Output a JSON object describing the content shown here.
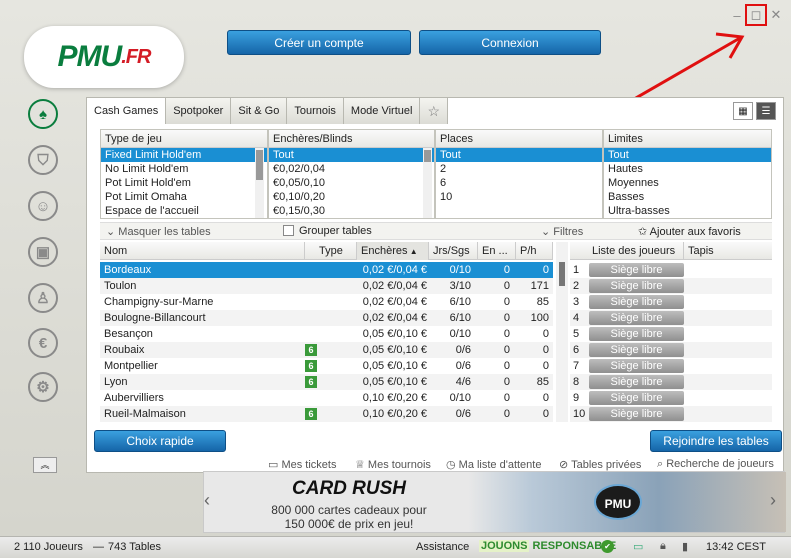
{
  "brand": {
    "main": "PMU",
    "tld": ".FR"
  },
  "header": {
    "create_account": "Créer un compte",
    "login": "Connexion",
    "minimize": "–",
    "restore": "◻",
    "close": "✕"
  },
  "sidebar": {
    "icons": [
      "spade-icon",
      "shield-icon",
      "group-icon",
      "gift-icon",
      "user-icon",
      "euro-icon",
      "wrench-icon"
    ]
  },
  "tabs": [
    "Cash Games",
    "Spotpoker",
    "Sit & Go",
    "Tournois",
    "Mode Virtuel"
  ],
  "filters": {
    "type": {
      "header": "Type de jeu",
      "items": [
        "Fixed Limit Hold'em",
        "No Limit Hold'em",
        "Pot Limit Hold'em",
        "Pot Limit Omaha",
        "Espace de l'accueil"
      ]
    },
    "blinds": {
      "header": "Enchères/Blinds",
      "items": [
        "Tout",
        "€0,02/0,04",
        "€0,05/0,10",
        "€0,10/0,20",
        "€0,15/0,30"
      ]
    },
    "places": {
      "header": "Places",
      "items": [
        "Tout",
        "2",
        "6",
        "10"
      ]
    },
    "limits": {
      "header": "Limites",
      "items": [
        "Tout",
        "Hautes",
        "Moyennes",
        "Basses",
        "Ultra-basses"
      ]
    }
  },
  "toolbar": {
    "hide_tables": "Masquer les tables",
    "group_tables": "Grouper tables",
    "filters": "Filtres",
    "add_fav": "Ajouter aux favoris"
  },
  "table": {
    "headers": {
      "name": "Nom",
      "type": "Type",
      "stakes": "Enchères",
      "players": "Jrs/Sgs",
      "waiting": "En ...",
      "pf": "P/h",
      "seat": "Liste des joueurs",
      "mats": "Tapis"
    },
    "rows": [
      {
        "name": "Bordeaux",
        "six": "",
        "stakes": "0,02 €/0,04 €",
        "players": "0/10",
        "waiting": "0",
        "pf": "0"
      },
      {
        "name": "Toulon",
        "six": "",
        "stakes": "0,02 €/0,04 €",
        "players": "3/10",
        "waiting": "0",
        "pf": "171"
      },
      {
        "name": "Champigny-sur-Marne",
        "six": "",
        "stakes": "0,02 €/0,04 €",
        "players": "6/10",
        "waiting": "0",
        "pf": "85"
      },
      {
        "name": "Boulogne-Billancourt",
        "six": "",
        "stakes": "0,02 €/0,04 €",
        "players": "6/10",
        "waiting": "0",
        "pf": "100"
      },
      {
        "name": "Besançon",
        "six": "",
        "stakes": "0,05 €/0,10 €",
        "players": "0/10",
        "waiting": "0",
        "pf": "0"
      },
      {
        "name": "Roubaix",
        "six": "6",
        "stakes": "0,05 €/0,10 €",
        "players": "0/6",
        "waiting": "0",
        "pf": "0"
      },
      {
        "name": "Montpellier",
        "six": "6",
        "stakes": "0,05 €/0,10 €",
        "players": "0/6",
        "waiting": "0",
        "pf": "0"
      },
      {
        "name": "Lyon",
        "six": "6",
        "stakes": "0,05 €/0,10 €",
        "players": "4/6",
        "waiting": "0",
        "pf": "85"
      },
      {
        "name": "Aubervilliers",
        "six": "",
        "stakes": "0,10 €/0,20 €",
        "players": "0/10",
        "waiting": "0",
        "pf": "0"
      },
      {
        "name": "Rueil-Malmaison",
        "six": "6",
        "stakes": "0,10 €/0,20 €",
        "players": "0/6",
        "waiting": "0",
        "pf": "0"
      }
    ],
    "seats": [
      {
        "n": "1",
        "label": "Siège libre"
      },
      {
        "n": "2",
        "label": "Siège libre"
      },
      {
        "n": "3",
        "label": "Siège libre"
      },
      {
        "n": "4",
        "label": "Siège libre"
      },
      {
        "n": "5",
        "label": "Siège libre"
      },
      {
        "n": "6",
        "label": "Siège libre"
      },
      {
        "n": "7",
        "label": "Siège libre"
      },
      {
        "n": "8",
        "label": "Siège libre"
      },
      {
        "n": "9",
        "label": "Siège libre"
      },
      {
        "n": "10",
        "label": "Siège libre"
      }
    ]
  },
  "actions": {
    "quick": "Choix rapide",
    "join": "Rejoindre les tables"
  },
  "links": [
    "Mes tickets",
    "Mes tournois",
    "Ma liste d'attente",
    "Tables privées",
    "Recherche de joueurs"
  ],
  "banner": {
    "title": "CARD RUSH",
    "line1": "800 000 cartes cadeaux pour",
    "line2": "150 000€ de prix en jeu!",
    "badge": "PMU"
  },
  "status": {
    "players": "2 110 Joueurs",
    "sep": "—",
    "tables": "743 Tables",
    "assist": "Assistance",
    "jouons": "JOUONS",
    "responsable": "RESPONSABLE",
    "time": "13:42 CEST"
  },
  "colors": {
    "accent": "#1a8fd3",
    "brand_green": "#0a7d3e",
    "brand_red": "#d41b25",
    "highlight": "#e01010"
  }
}
